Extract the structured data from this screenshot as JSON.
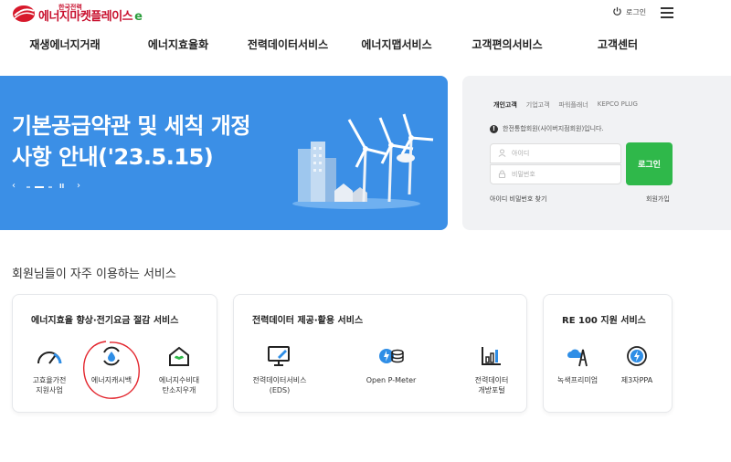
{
  "header": {
    "logo_sub": "한국전력",
    "logo_main": "에너지마켓플레이스",
    "logo_badge": "e",
    "login_label": "로그인",
    "power_icon": "power-icon",
    "menu_icon": "hamburger-menu-icon"
  },
  "nav": {
    "items": [
      {
        "label": "재생에너지거래"
      },
      {
        "label": "에너지효율화"
      },
      {
        "label": "전력데이터서비스"
      },
      {
        "label": "에너지맵서비스"
      },
      {
        "label": "고객편의서비스"
      },
      {
        "label": "고객센터"
      }
    ]
  },
  "banner": {
    "title_line1": "기본공급약관 및 세칙 개정",
    "title_line2": "사항 안내('23.5.15)",
    "prev": "‹",
    "next": "›",
    "pause": "II",
    "bg_color": "#3b8fe6"
  },
  "login": {
    "tabs": [
      {
        "label": "개인고객"
      },
      {
        "label": "기업고객"
      },
      {
        "label": "파워플래너"
      },
      {
        "label": "KEPCO PLUG"
      }
    ],
    "notice": "한전통합회원(사이버지점회원)입니다.",
    "id_placeholder": "아이디",
    "pw_placeholder": "비밀번호",
    "button": "로그인",
    "find": "아이디 비밀번호 찾기",
    "join": "회원가입",
    "button_color": "#2fb84a"
  },
  "services": {
    "title": "회원님들이 자주 이용하는 서비스",
    "cards": [
      {
        "title": "에너지효율 향상·전기요금 절감 서비스",
        "items": [
          {
            "line1": "고효율가전",
            "line2": "지원사업",
            "icon": "gauge-icon"
          },
          {
            "line1": "에너지캐시백",
            "line2": "",
            "icon": "water-drop-refresh-icon"
          },
          {
            "line1": "에너지수비대",
            "line2": "탄소지우개",
            "icon": "leaf-house-icon"
          }
        ]
      },
      {
        "title": "전력데이터 제공·활용 서비스",
        "items": [
          {
            "line1": "전력데이터서비스",
            "line2": "(EDS)",
            "icon": "monitor-edit-icon"
          },
          {
            "line1": "Open P-Meter",
            "line2": "",
            "icon": "meter-icon"
          },
          {
            "line1": "전력데이터",
            "line2": "개방포털",
            "icon": "bar-chart-icon"
          }
        ]
      },
      {
        "title": "RE 100 지원 서비스",
        "items": [
          {
            "line1": "녹색프리미엄",
            "line2": "",
            "icon": "cloud-tower-icon"
          },
          {
            "line1": "제3자PPA",
            "line2": "",
            "icon": "lightning-circle-icon"
          }
        ]
      }
    ]
  }
}
